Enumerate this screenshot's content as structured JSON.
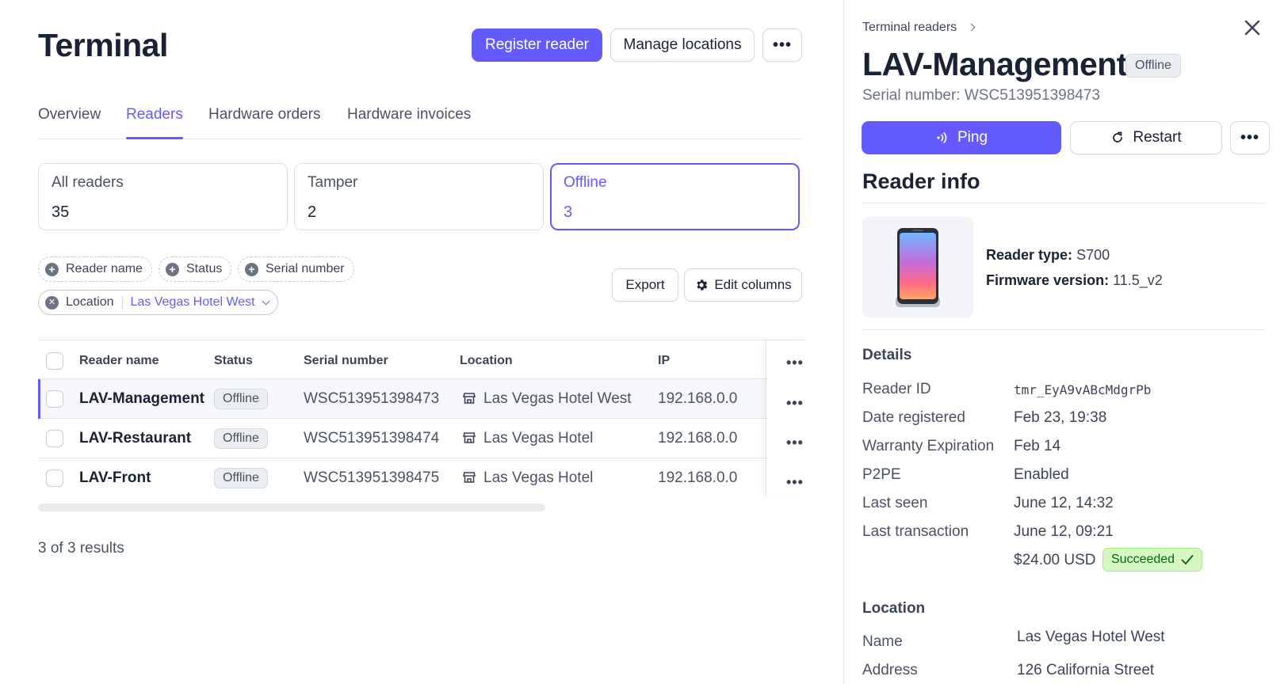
{
  "header": {
    "title": "Terminal",
    "register_label": "Register reader",
    "manage_label": "Manage locations",
    "more_label": "•••"
  },
  "tabs": [
    {
      "label": "Overview"
    },
    {
      "label": "Readers",
      "active": true
    },
    {
      "label": "Hardware orders"
    },
    {
      "label": "Hardware invoices"
    }
  ],
  "summary_cards": [
    {
      "label": "All readers",
      "value": "35"
    },
    {
      "label": "Tamper",
      "value": "2"
    },
    {
      "label": "Offline",
      "value": "3",
      "selected": true
    }
  ],
  "filters": {
    "reader_name": "Reader name",
    "status": "Status",
    "serial_number": "Serial number",
    "location_label": "Location",
    "location_value": "Las Vegas Hotel West"
  },
  "toolbar": {
    "export_label": "Export",
    "edit_columns_label": "Edit columns"
  },
  "table": {
    "columns": [
      "Reader name",
      "Status",
      "Serial number",
      "Location",
      "IP"
    ],
    "rows": [
      {
        "name": "LAV-Management",
        "status": "Offline",
        "serial": "WSC513951398473",
        "location": "Las Vegas Hotel West",
        "ip": "192.168.0.0"
      },
      {
        "name": "LAV-Restaurant",
        "status": "Offline",
        "serial": "WSC513951398474",
        "location": "Las Vegas Hotel",
        "ip": "192.168.0.0"
      },
      {
        "name": "LAV-Front",
        "status": "Offline",
        "serial": "WSC513951398475",
        "location": "Las Vegas Hotel",
        "ip": "192.168.0.0"
      }
    ],
    "results_text": "3 of 3 results"
  },
  "panel": {
    "breadcrumb": "Terminal readers",
    "title": "LAV-Management",
    "status": "Offline",
    "serial": "Serial number: WSC513951398473",
    "ping_label": "Ping",
    "restart_label": "Restart",
    "more_label": "•••",
    "reader_info_title": "Reader info",
    "reader_type_label": "Reader type:",
    "reader_type_value": "S700",
    "firmware_label": "Firmware version:",
    "firmware_value": "11.5_v2",
    "details_title": "Details",
    "details": [
      {
        "label": "Reader ID",
        "value": "tmr_EyA9vABcMdgrPb"
      },
      {
        "label": "Date registered",
        "value": "Feb 23, 19:38"
      },
      {
        "label": "Warranty Expiration",
        "value": "Feb 14"
      },
      {
        "label": "P2PE",
        "value": "Enabled"
      },
      {
        "label": "Last seen",
        "value": "June 12, 14:32"
      },
      {
        "label": "Last transaction",
        "value": "June 12, 09:21"
      }
    ],
    "transaction_amount": "$24.00 USD",
    "transaction_status": "Succeeded",
    "location_title": "Location",
    "location": [
      {
        "label": "Name",
        "value": "Las Vegas Hotel West"
      },
      {
        "label": "Address",
        "value": "126 California Street"
      }
    ]
  },
  "colors": {
    "accent": "#635bff",
    "text": "#1a2236",
    "muted": "#4a5264",
    "success_bg": "#d7f7c2",
    "success_text": "#05690d"
  }
}
